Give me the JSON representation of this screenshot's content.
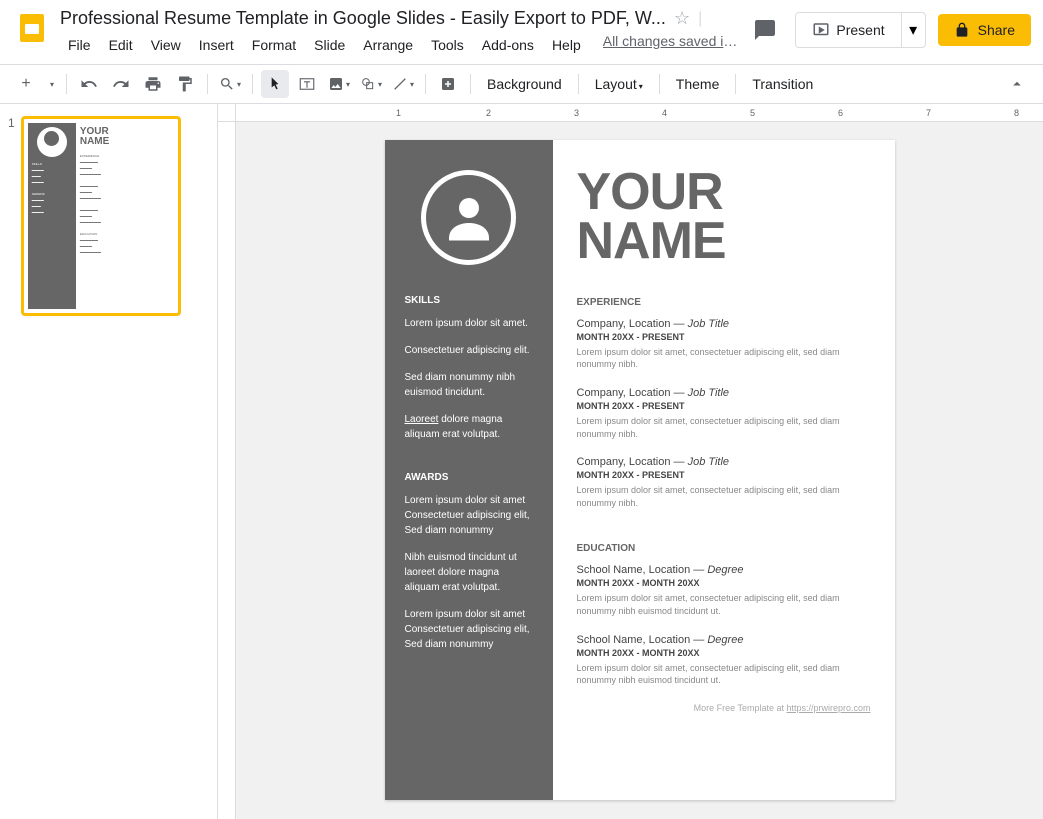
{
  "doc": {
    "title": "Professional Resume Template in Google Slides - Easily Export to PDF, W...",
    "saved": "All changes saved in ..."
  },
  "menu": {
    "file": "File",
    "edit": "Edit",
    "view": "View",
    "insert": "Insert",
    "format": "Format",
    "slide": "Slide",
    "arrange": "Arrange",
    "tools": "Tools",
    "addons": "Add-ons",
    "help": "Help"
  },
  "buttons": {
    "present": "Present",
    "share": "Share"
  },
  "toolbar": {
    "background": "Background",
    "layout": "Layout",
    "theme": "Theme",
    "transition": "Transition"
  },
  "thumb": {
    "num": "1"
  },
  "resume": {
    "name1": "YOUR",
    "name2": "NAME",
    "skills_h": "SKILLS",
    "skill1": "Lorem ipsum dolor sit amet.",
    "skill2": "Consectetuer adipiscing elit.",
    "skill3": "Sed diam nonummy nibh euismod tincidunt.",
    "skill4": "Laoreet dolore magna aliquam erat volutpat.",
    "awards_h": "AWARDS",
    "award1": "Lorem ipsum dolor sit amet Consectetuer adipiscing elit, Sed diam nonummy",
    "award2": "Nibh euismod tincidunt ut laoreet dolore magna aliquam erat volutpat.",
    "award3": "Lorem ipsum dolor sit amet Consectetuer adipiscing elit, Sed diam nonummy",
    "exp_h": "EXPERIENCE",
    "exp_line": "Company, Location — ",
    "exp_title": "Job Title",
    "exp_date": "MONTH 20XX - PRESENT",
    "exp_desc": "Lorem ipsum dolor sit amet, consectetuer adipiscing elit, sed diam nonummy nibh.",
    "edu_h": "EDUCATION",
    "edu_line": "School Name, Location — ",
    "edu_title": "Degree",
    "edu_date": "MONTH 20XX - MONTH 20XX",
    "edu_desc1": "Lorem ipsum dolor sit amet, consectetuer adipiscing elit, sed diam nonummy nibh euismod tincidunt ut.",
    "edu_desc2": "Lorem ipsum dolor sit amet, consectetuer adipiscing elit, sed diam nonummy nibh euismod tincidunt ut.",
    "footer": "More Free Template at ",
    "footer_link": "https://prwirepro.com"
  }
}
